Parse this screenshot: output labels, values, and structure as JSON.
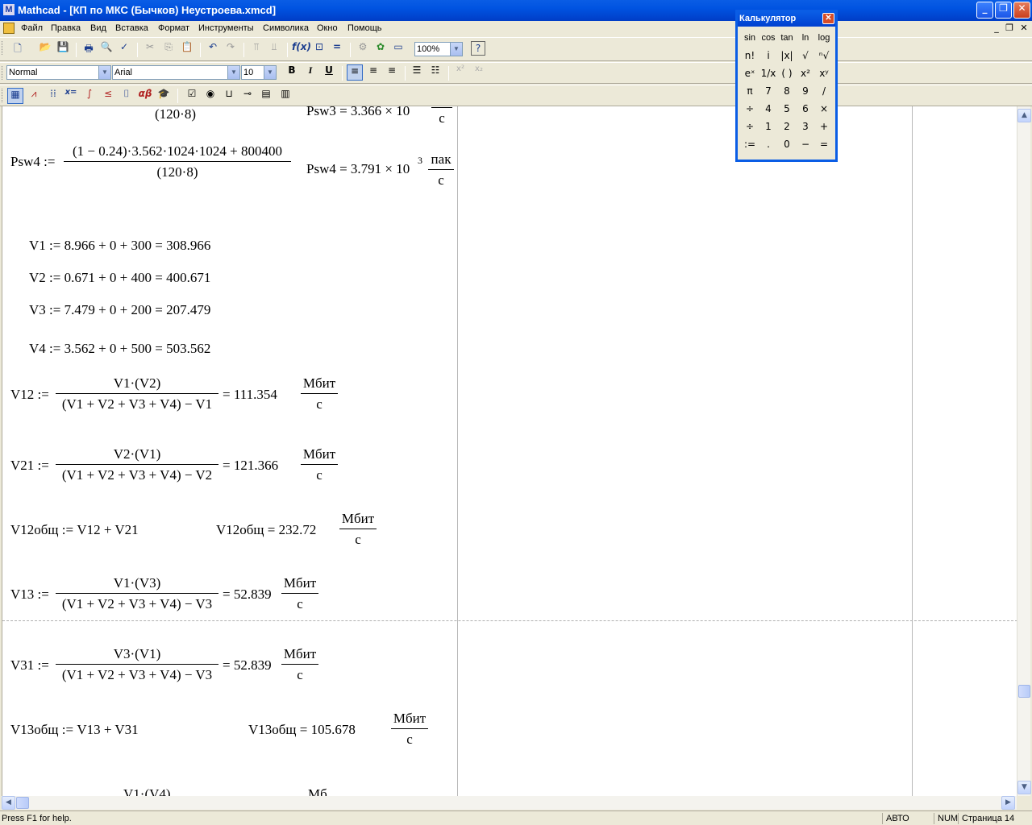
{
  "window": {
    "title": "Mathcad - [КП по МКС (Бычков) Неустроева.xmcd]",
    "logo_letter": "M",
    "minimize_glyph": "_",
    "restore_glyph": "❐",
    "close_glyph": "✕"
  },
  "menu": {
    "items": [
      "Файл",
      "Правка",
      "Вид",
      "Вставка",
      "Формат",
      "Инструменты",
      "Символика",
      "Окно",
      "Помощь"
    ],
    "mdi_minimize": "_",
    "mdi_restore": "❐",
    "mdi_close": "✕"
  },
  "toolbar_standard": {
    "zoom": "100%",
    "help_glyph": "?"
  },
  "toolbar_format": {
    "style": "Normal",
    "font": "Arial",
    "size": "10",
    "bold": "B",
    "italic": "I",
    "underline": "U",
    "superscript": "x²",
    "subscript": "x₂"
  },
  "toolbar_math": {
    "equal_eval": "x=",
    "greek": "αβ"
  },
  "document": {
    "psw3_partial_den": "(120·8)",
    "psw3_partial_result": "Psw3 = 3.366 × 10",
    "psw3_partial_unit_den": "с",
    "psw4": {
      "lhs": "Psw4 :=",
      "num": "(1 − 0.24)·3.562·1024·1024 + 800400",
      "den": "(120·8)",
      "result": "Psw4 = 3.791 × 10",
      "exp": "3",
      "unit_num": "пак",
      "unit_den": "с"
    },
    "v1": "V1 := 8.966 + 0 + 300 = 308.966",
    "v2": "V2 := 0.671 + 0 + 400 = 400.671",
    "v3": "V3 := 7.479 + 0 + 200 = 207.479",
    "v4": "V4 := 3.562 + 0 + 500 = 503.562",
    "v12": {
      "lhs": "V12 :=",
      "num": "V1·(V2)",
      "den": "(V1 + V2 + V3 + V4) − V1",
      "result": "= 111.354",
      "unit_num": "Мбит",
      "unit_den": "с"
    },
    "v21": {
      "lhs": "V21 :=",
      "num": "V2·(V1)",
      "den": "(V1 + V2 + V3 + V4) − V2",
      "result": "= 121.366",
      "unit_num": "Мбит",
      "unit_den": "с"
    },
    "v12total": {
      "def": "V12общ := V12 + V21",
      "result": "V12общ = 232.72",
      "unit_num": "Мбит",
      "unit_den": "с"
    },
    "v13": {
      "lhs": "V13 :=",
      "num": "V1·(V3)",
      "den": "(V1 + V2 + V3 + V4) − V3",
      "result": "= 52.839",
      "unit_num": "Мбит",
      "unit_den": "с"
    },
    "v31": {
      "lhs": "V31 :=",
      "num": "V3·(V1)",
      "den": "(V1 + V2 + V3 + V4) − V3",
      "result": "= 52.839",
      "unit_num": "Мбит",
      "unit_den": "с"
    },
    "v13total": {
      "def": "V13общ := V13 + V31",
      "result": "V13общ = 105.678",
      "unit_num": "Мбит",
      "unit_den": "с"
    },
    "partial_bottom_num": "V1·(V4)",
    "partial_bottom_unit": "Мб"
  },
  "calculator": {
    "title": "Калькулятор",
    "close_glyph": "✕",
    "rows": [
      [
        "sin",
        "cos",
        "tan",
        "ln",
        "log"
      ],
      [
        "n!",
        "i",
        "|x|",
        "√",
        "ⁿ√"
      ],
      [
        "eˣ",
        "1/x",
        "( )",
        "x²",
        "xʸ"
      ],
      [
        "π",
        "7",
        "8",
        "9",
        "/"
      ],
      [
        "÷",
        "4",
        "5",
        "6",
        "×"
      ],
      [
        "÷",
        "1",
        "2",
        "3",
        "+"
      ],
      [
        ":=",
        ".",
        "0",
        "−",
        "="
      ]
    ]
  },
  "status": {
    "help": "Press F1 for help.",
    "mode": "АВТО",
    "num": "NUM",
    "page": "Страница 14"
  }
}
